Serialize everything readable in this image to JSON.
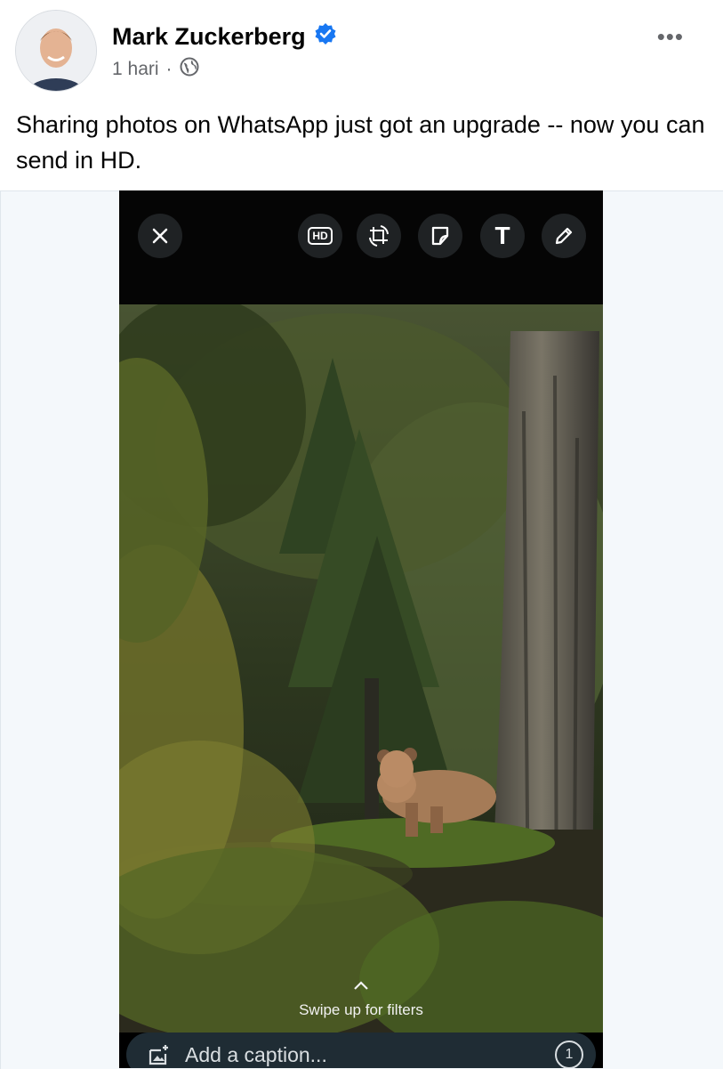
{
  "post": {
    "author": "Mark Zuckerberg",
    "verified": true,
    "time": "1 hari",
    "separator": "·",
    "audience_icon": "globe-icon",
    "more_label": "•••",
    "text": "Sharing photos on WhatsApp just got an upgrade -- now you can send in HD."
  },
  "editor": {
    "toolbar": {
      "close_icon": "close-icon",
      "hd_label": "HD",
      "crop_icon": "crop-rotate-icon",
      "sticker_icon": "sticker-icon",
      "text_label": "T",
      "draw_icon": "pencil-icon"
    },
    "swipe_hint": "Swipe up for filters",
    "caption_placeholder": "Add a caption...",
    "view_once_label": "1"
  },
  "colors": {
    "verified": "#1877f2",
    "toolbar_bg": "#050505",
    "caption_bg": "#1f2c34"
  }
}
